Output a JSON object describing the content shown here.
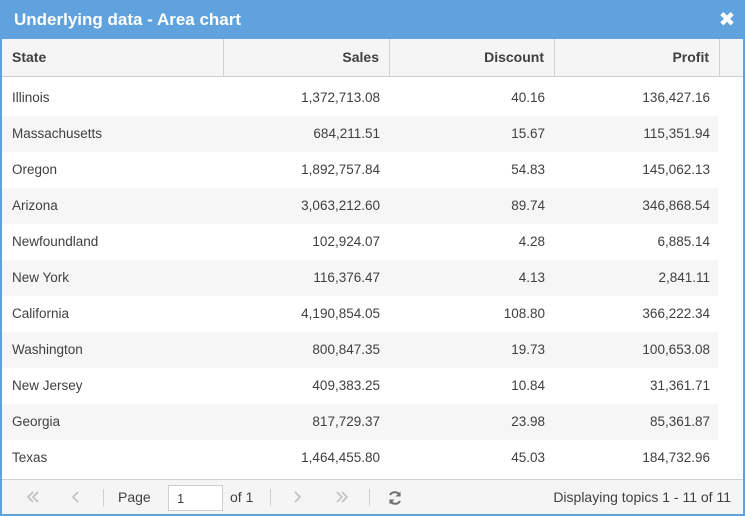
{
  "window": {
    "title": "Underlying data - Area chart",
    "close_glyph": "✖"
  },
  "columns": [
    {
      "label": "State",
      "align": "left"
    },
    {
      "label": "Sales",
      "align": "right"
    },
    {
      "label": "Discount",
      "align": "right"
    },
    {
      "label": "Profit",
      "align": "right"
    }
  ],
  "rows": [
    {
      "state": "Illinois",
      "sales": "1,372,713.08",
      "discount": "40.16",
      "profit": "136,427.16"
    },
    {
      "state": "Massachusetts",
      "sales": "684,211.51",
      "discount": "15.67",
      "profit": "115,351.94"
    },
    {
      "state": "Oregon",
      "sales": "1,892,757.84",
      "discount": "54.83",
      "profit": "145,062.13"
    },
    {
      "state": "Arizona",
      "sales": "3,063,212.60",
      "discount": "89.74",
      "profit": "346,868.54"
    },
    {
      "state": "Newfoundland",
      "sales": "102,924.07",
      "discount": "4.28",
      "profit": "6,885.14"
    },
    {
      "state": "New York",
      "sales": "116,376.47",
      "discount": "4.13",
      "profit": "2,841.11"
    },
    {
      "state": "California",
      "sales": "4,190,854.05",
      "discount": "108.80",
      "profit": "366,222.34"
    },
    {
      "state": "Washington",
      "sales": "800,847.35",
      "discount": "19.73",
      "profit": "100,653.08"
    },
    {
      "state": "New Jersey",
      "sales": "409,383.25",
      "discount": "10.84",
      "profit": "31,361.71"
    },
    {
      "state": "Georgia",
      "sales": "817,729.37",
      "discount": "23.98",
      "profit": "85,361.87"
    },
    {
      "state": "Texas",
      "sales": "1,464,455.80",
      "discount": "45.03",
      "profit": "184,732.96"
    }
  ],
  "pager": {
    "page_label": "Page",
    "page_value": "1",
    "of_label": "of 1",
    "info": "Displaying topics 1 - 11 of 11",
    "icons": [
      "first-page-icon",
      "previous-page-icon",
      "next-page-icon",
      "last-page-icon",
      "refresh-icon"
    ]
  },
  "colors": {
    "titlebar": "#5fa2dd",
    "header_bg": "#f5f5f5",
    "row_alt_bg": "#f6f6f6",
    "text": "#404040",
    "disabled_icon": "#c0c0c0"
  }
}
